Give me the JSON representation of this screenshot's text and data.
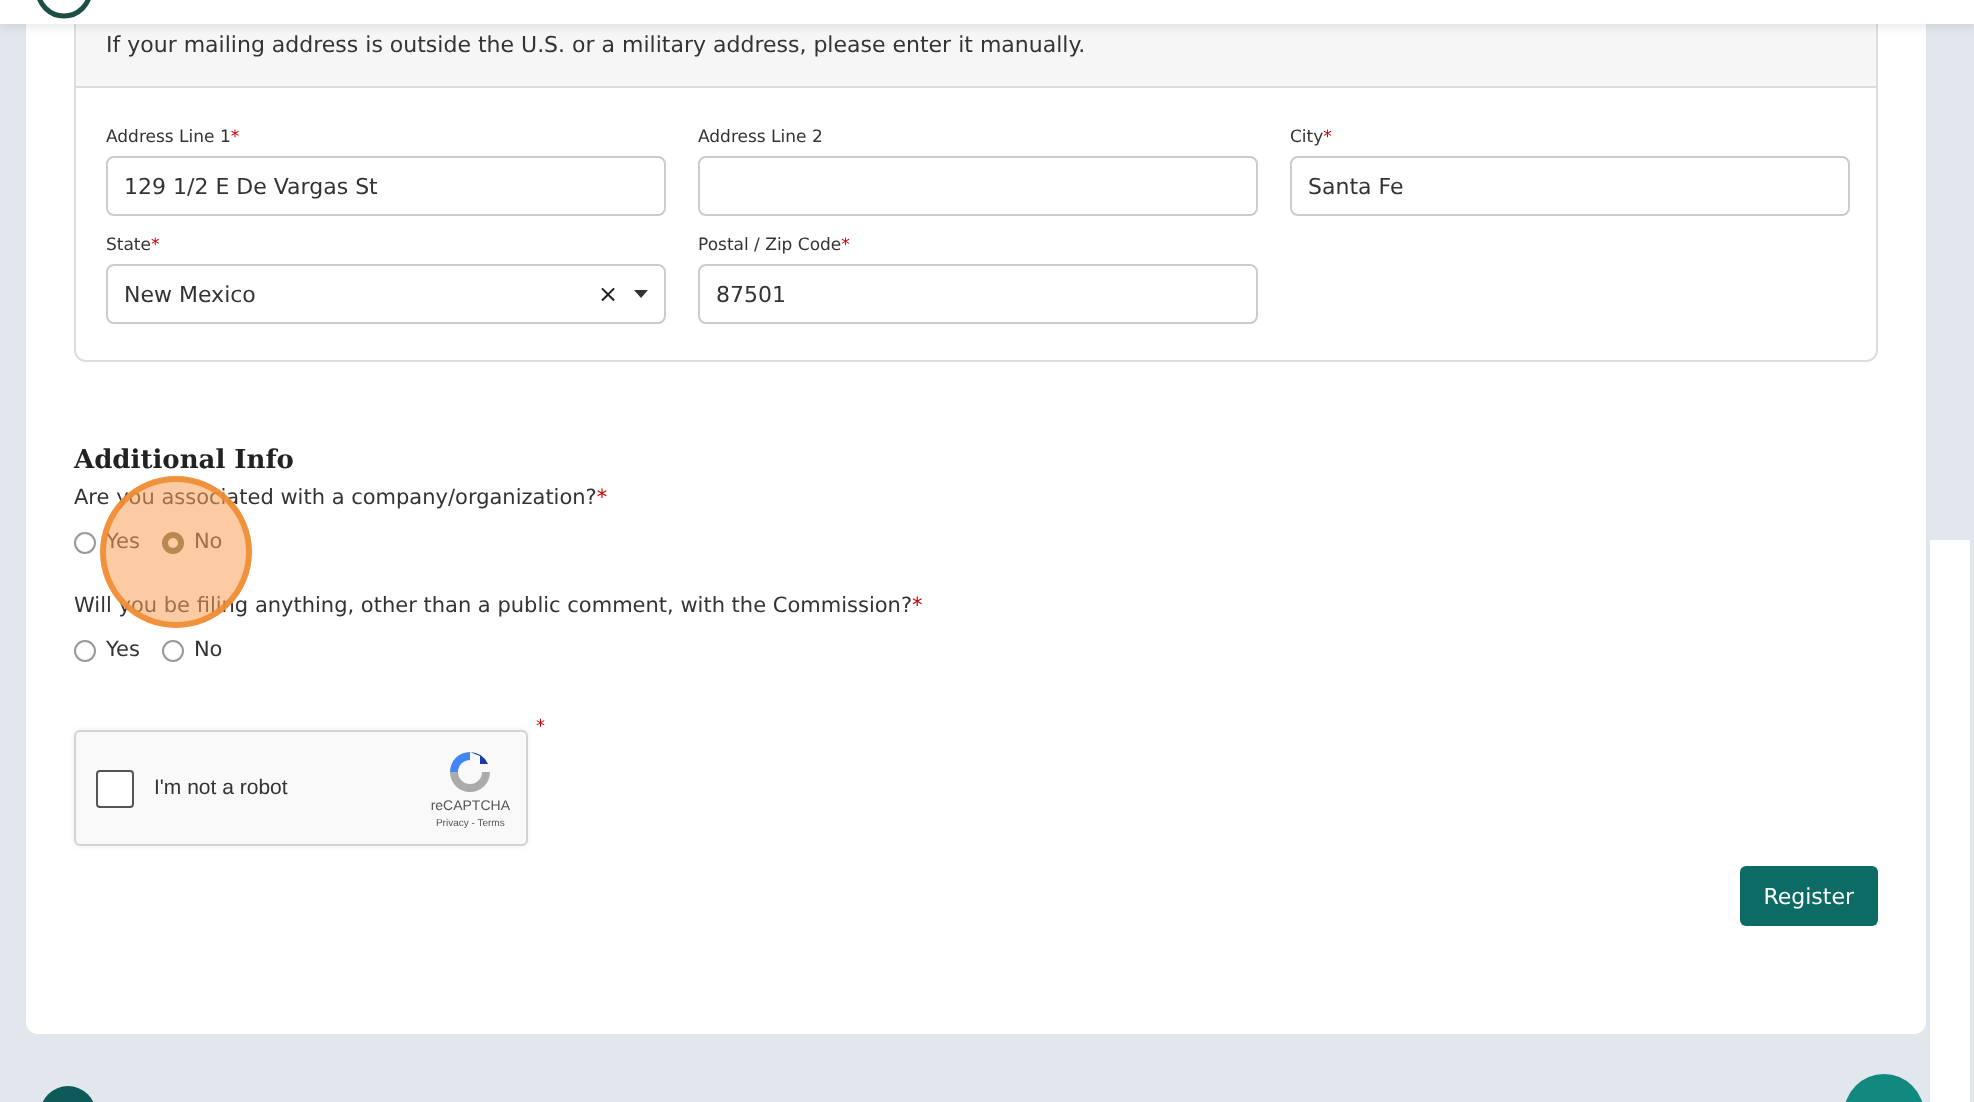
{
  "address": {
    "note": "If your mailing address is outside the U.S. or a military address, please enter it manually.",
    "fields": [
      {
        "label": "Address Line 1",
        "mark": "*",
        "kind": "text",
        "value": "129 1/2 E De Vargas St"
      },
      {
        "label": "Address Line 2",
        "kind": "text"
      },
      {
        "label": "City",
        "mark": "*",
        "kind": "text",
        "value": "Santa Fe"
      },
      {
        "label": "State",
        "mark": "*",
        "kind": "select",
        "value": "New Mexico",
        "clear": "×"
      },
      {
        "label": "Postal / Zip Code",
        "mark": "*",
        "kind": "text",
        "value": "87501"
      }
    ]
  },
  "additional_info": {
    "title": "Additional Info",
    "questions": [
      {
        "text": "Are you associated with a company/organization?",
        "mark": "*",
        "options": [
          {
            "label": "Yes",
            "selected": false
          },
          {
            "label": "No",
            "selected": true
          }
        ]
      },
      {
        "text": "Will you be filing anything, other than a public comment, with the Commission?",
        "mark": "*",
        "options": [
          {
            "label": "Yes",
            "selected": false
          },
          {
            "label": "No",
            "selected": false
          }
        ]
      }
    ]
  },
  "captcha": {
    "label": "I'm not a robot",
    "checked": false,
    "mark": "*",
    "brand": "reCAPTCHA",
    "links": "Privacy - Terms"
  },
  "buttons": [
    "Register"
  ]
}
